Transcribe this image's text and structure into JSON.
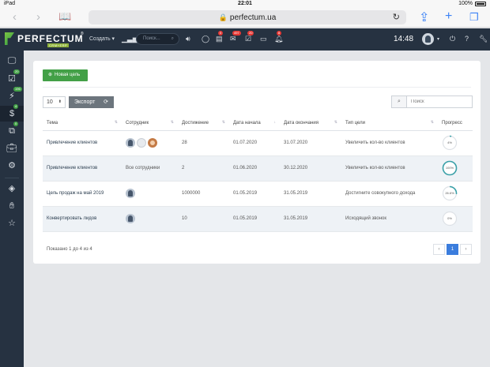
{
  "status_bar": {
    "device": "iPad",
    "time": "22:01",
    "battery": "100%"
  },
  "browser": {
    "url": "perfectum.ua"
  },
  "header": {
    "logo_name": "PERFECTUM",
    "logo_sub": "CRM+ERP",
    "logo_reg": "®",
    "create_label": "Создать",
    "search_placeholder": "Поиск...",
    "badges": {
      "tasks": "0",
      "mail": "497",
      "requests": "20",
      "notifications": "8"
    },
    "time": "14:48"
  },
  "sidebar": {
    "items": [
      {
        "icon": "monitor-icon"
      },
      {
        "icon": "checkbox-icon",
        "badge": "20"
      },
      {
        "icon": "lightning-icon",
        "badge": "196"
      },
      {
        "icon": "dollar-icon",
        "badge": "4"
      },
      {
        "icon": "copy-icon",
        "badge": "0"
      },
      {
        "icon": "briefcase-icon"
      },
      {
        "icon": "settings-icon"
      },
      {
        "icon": "layers-icon"
      },
      {
        "icon": "hand-icon"
      },
      {
        "icon": "star-icon"
      }
    ]
  },
  "toolbar": {
    "new_goal_label": "Новая цель",
    "page_length": "10",
    "export_label": "Экспорт",
    "search_placeholder": "Поиск"
  },
  "table": {
    "columns": [
      "Тема",
      "Сотрудник",
      "Достижение",
      "Дата начала",
      "Дата окончания",
      "Тип цели",
      "Прогресс"
    ],
    "rows": [
      {
        "topic": "Привлечение клиентов",
        "employee": "",
        "achievement": "28",
        "start": "01.07.2020",
        "end": "31.07.2020",
        "type": "Увеличить кол-во клиентов",
        "progress_label": "4%",
        "progress": 4
      },
      {
        "topic": "Привлечение клиентов",
        "employee": "Все сотрудники",
        "achievement": "2",
        "start": "01.06.2020",
        "end": "30.12.2020",
        "type": "Увеличить кол-во клиентов",
        "progress_label": "100%",
        "progress": 100
      },
      {
        "topic": "Цель продаж на май 2019",
        "employee": "",
        "achievement": "1000000",
        "start": "01.05.2019",
        "end": "31.05.2019",
        "type": "Достигните совокупного дохода",
        "progress_label": "26.6%",
        "progress": 26.6
      },
      {
        "topic": "Конвертировать лидов",
        "employee": "",
        "achievement": "10",
        "start": "01.05.2019",
        "end": "31.05.2019",
        "type": "Исходящий звонок",
        "progress_label": "0%",
        "progress": 0
      }
    ]
  },
  "footer": {
    "info": "Показано 1 до 4 из 4",
    "prev": "‹",
    "page": "1",
    "next": "›"
  }
}
